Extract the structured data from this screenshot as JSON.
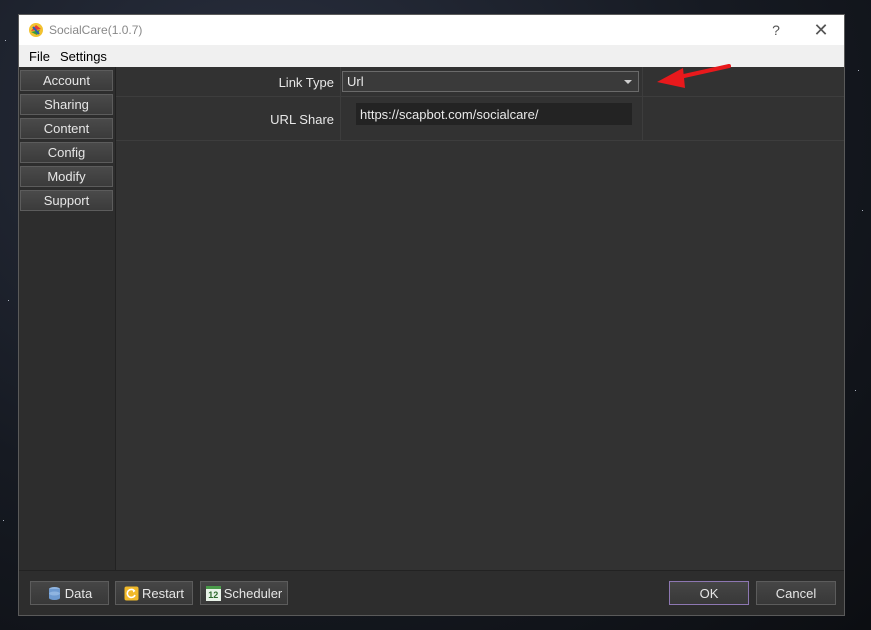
{
  "window": {
    "title": "SocialCare(1.0.7)",
    "help": "?",
    "close": "✕"
  },
  "menu": {
    "file": "File",
    "settings": "Settings"
  },
  "sidebar": {
    "items": [
      {
        "label": "Account"
      },
      {
        "label": "Sharing"
      },
      {
        "label": "Content"
      },
      {
        "label": "Config"
      },
      {
        "label": "Modify"
      },
      {
        "label": "Support"
      }
    ]
  },
  "form": {
    "link_type_label": "Link Type",
    "link_type_value": "Url",
    "url_share_label": "URL Share",
    "url_share_value": "https://scapbot.com/socialcare/"
  },
  "bottom": {
    "data": "Data",
    "restart": "Restart",
    "scheduler": "Scheduler",
    "scheduler_icon_num": "12",
    "ok": "OK",
    "cancel": "Cancel"
  },
  "colors": {
    "annotation_arrow": "#e8191c",
    "ok_border": "#8d77b2"
  }
}
